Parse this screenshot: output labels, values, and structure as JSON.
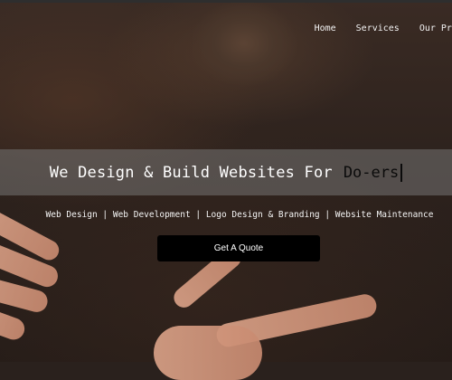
{
  "nav": {
    "items": [
      "Home",
      "Services",
      "Our Proc"
    ]
  },
  "hero": {
    "headline": "We Design & Build Websites For",
    "typed_word": "Do-ers",
    "services_line": "Web Design | Web Development | Logo Design & Branding | Website Maintenance",
    "cta_label": "Get A Quote"
  },
  "colors": {
    "banner_overlay": "#787878",
    "cta_background": "#000000",
    "text": "#ffffff"
  }
}
